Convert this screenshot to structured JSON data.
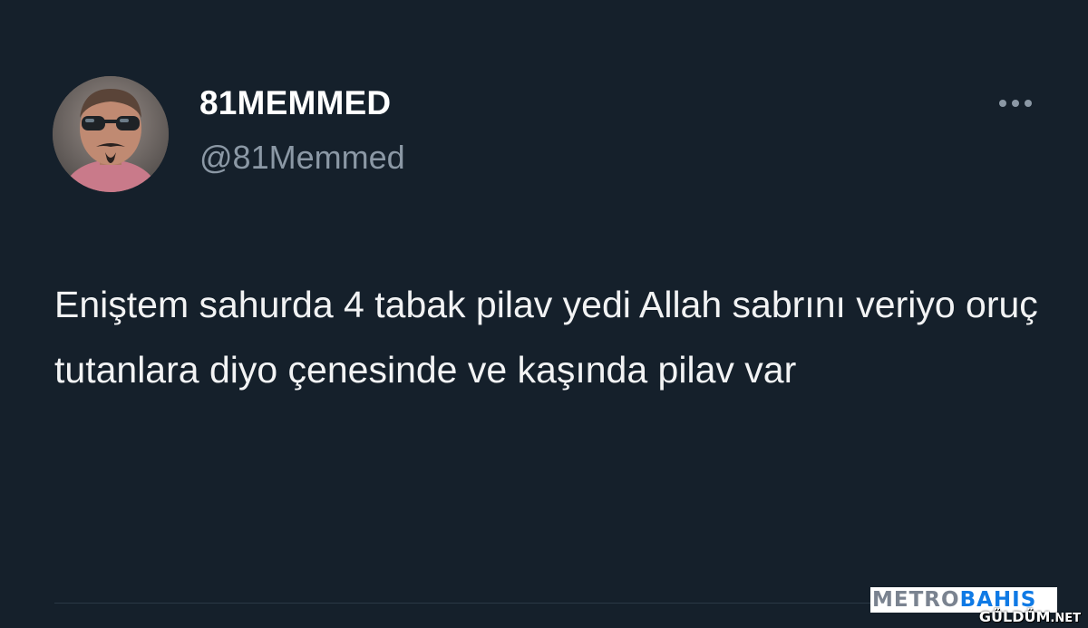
{
  "tweet": {
    "display_name": "81MEMMED",
    "handle": "@81Memmed",
    "text": "Eniştem sahurda 4 tabak pilav yedi Allah sabrını veriyo oruç tutanlara diyo çenesinde ve kaşında pilav var",
    "more_icon": "more-horizontal-icon"
  },
  "watermarks": {
    "metro": "METRO",
    "bahis": "BAHIS",
    "guldum": "GÜLDÜM",
    "guldum_suffix": ".NET"
  },
  "colors": {
    "background": "#15202b",
    "name": "#ffffff",
    "handle": "#8b98a5",
    "text": "#f2f3f4",
    "divider": "#2a3845",
    "watermark_blue": "#0f7ae5"
  }
}
